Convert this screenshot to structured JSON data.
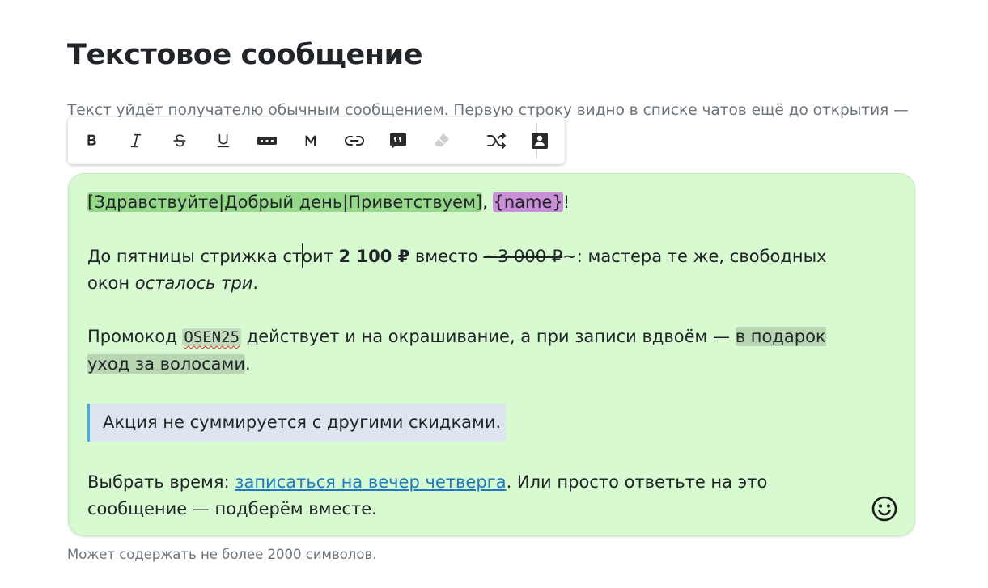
{
  "page": {
    "title": "Текстовое сообщение",
    "hint": "Текст уйдёт получателю обычным сообщением. Первую строку видно в списке чатов ещё до открытия —",
    "footnote": "Может содержать не более 2000 символов."
  },
  "toolbar": {
    "buttons": [
      {
        "name": "bold-icon"
      },
      {
        "name": "italic-icon"
      },
      {
        "name": "strikethrough-icon"
      },
      {
        "name": "underline-icon"
      },
      {
        "name": "spoiler-icon"
      },
      {
        "name": "monospace-icon",
        "label": "M"
      },
      {
        "name": "link-icon"
      },
      {
        "name": "quote-icon"
      },
      {
        "name": "eraser-icon"
      },
      {
        "name": "shuffle-icon"
      },
      {
        "name": "contact-card-icon"
      }
    ]
  },
  "message": {
    "p1": {
      "variants": "[Здравствуйте|Добрый день|Приветствуем]",
      "sep": ",",
      "space": " ",
      "variable": "{name}",
      "end": "!"
    },
    "p2": {
      "t1": "До пятницы стрижка ст",
      "t2": "оит ",
      "price": "2 100 ₽",
      "t3": " вместо ",
      "old_price": "~3 000 ₽",
      "t4": "~: мастера те же, свободных окон ",
      "italic": "осталось три",
      "t5": "."
    },
    "p3": {
      "t1": "Промокод ",
      "promo": "OSEN25",
      "t2": " действует и на окрашивание, а при записи вдвоём — ",
      "spoiler": "в подарок уход за волосами",
      "t3": "."
    },
    "quote": "Акция не суммируется с другими скидками.",
    "p5": {
      "t1": "Выбрать время: ",
      "link": "записаться на вечер четверга",
      "t2": ". Или просто ответьте на это сообщение — подберём вместе."
    }
  },
  "colors": {
    "editor_bg": "#d7fad1",
    "variant_highlight": "#96d98a",
    "variable_highlight": "#c98ed8",
    "spoiler_highlight": "#b8d6b2",
    "quote_bg": "#dde6ee",
    "quote_border": "#45aee0",
    "link": "#1f7ac4"
  }
}
